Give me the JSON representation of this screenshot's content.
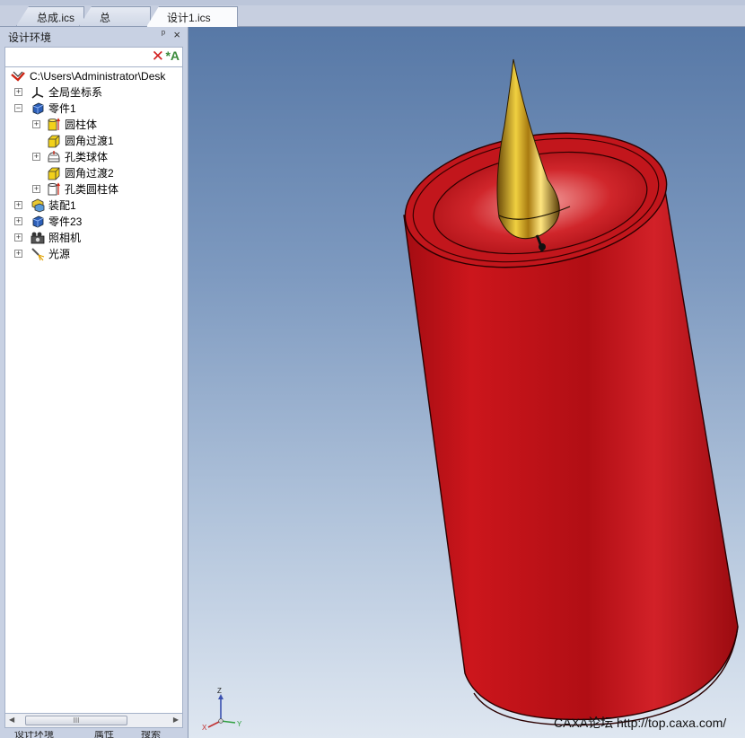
{
  "tabs": [
    {
      "label": "总成.ics",
      "active": false
    },
    {
      "label": "总成.exb",
      "active": false
    },
    {
      "label": "设计1.ics",
      "active": true
    }
  ],
  "tab_close_glyph": "×",
  "panel": {
    "title": "设计环境",
    "pin_glyph": "ᵖ",
    "close_glyph": "×"
  },
  "tree": {
    "root": "C:\\Users\\Administrator\\Desk",
    "items": [
      {
        "label": "全局坐标系",
        "icon": "axes-icon"
      },
      {
        "label": "零件1",
        "icon": "part-icon"
      },
      {
        "label": "圆柱体",
        "icon": "cylinder-feature-icon"
      },
      {
        "label": "圆角过渡1",
        "icon": "fillet-icon"
      },
      {
        "label": "孔类球体",
        "icon": "sphere-hole-icon"
      },
      {
        "label": "圆角过渡2",
        "icon": "fillet-icon"
      },
      {
        "label": "孔类圆柱体",
        "icon": "cylinder-hole-icon"
      },
      {
        "label": "装配1",
        "icon": "assembly-icon"
      },
      {
        "label": "零件23",
        "icon": "part-icon"
      },
      {
        "label": "照相机",
        "icon": "camera-icon"
      },
      {
        "label": "光源",
        "icon": "light-icon"
      }
    ]
  },
  "scrollbar_grip": "III",
  "bottom_tabs": [
    "设计环境",
    "属性",
    "搜索"
  ],
  "viewport": {
    "watermark": "CAXA论坛 http://top.caxa.com/",
    "triad": {
      "z": "Z",
      "x": "X",
      "y": "Y"
    }
  },
  "colors": {
    "candle_red": "#c8141a",
    "flame_gold": "#c8a018",
    "background_top": "#5778a6",
    "background_bottom": "#dfe7f1"
  }
}
